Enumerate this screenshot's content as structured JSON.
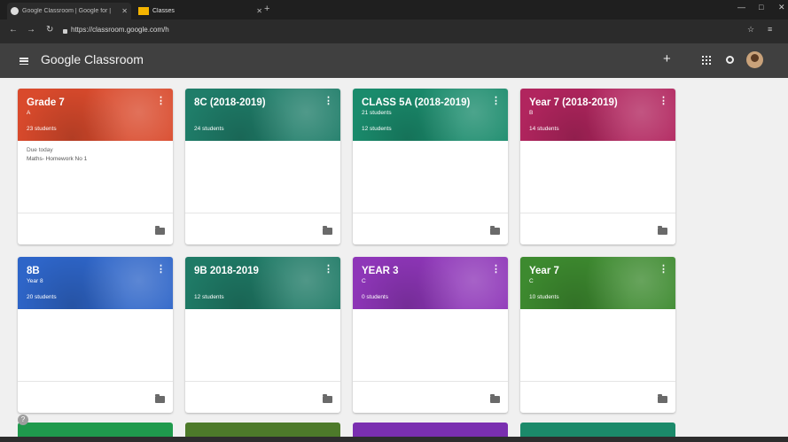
{
  "browser": {
    "tabs": [
      {
        "title": "Google Classroom | Google for |",
        "active": false
      },
      {
        "title": "Classes",
        "active": true
      }
    ],
    "url": "https://classroom.google.com/h"
  },
  "app": {
    "title": "Google Classroom"
  },
  "classes": [
    {
      "title": "Grade 7",
      "section": "A",
      "students": "23 students",
      "color": "#d94a2c",
      "due_label": "Due today",
      "due_item": "Maths- Homework No 1"
    },
    {
      "title": "8C (2018-2019)",
      "section": "",
      "students": "24 students",
      "color": "#1f7d69",
      "due_label": "",
      "due_item": ""
    },
    {
      "title": "CLASS 5A (2018-2019)",
      "section": "21 students",
      "students": "12 students",
      "color": "#1a8b6c",
      "due_label": "",
      "due_item": ""
    },
    {
      "title": "Year 7 (2018-2019)",
      "section": "B",
      "students": "14 students",
      "color": "#b1255e",
      "due_label": "",
      "due_item": ""
    },
    {
      "title": "8B",
      "section": "Year 8",
      "students": "20 students",
      "color": "#2e65c8",
      "due_label": "",
      "due_item": ""
    },
    {
      "title": "9B 2018-2019",
      "section": "",
      "students": "12 students",
      "color": "#1f7a66",
      "due_label": "",
      "due_item": ""
    },
    {
      "title": "YEAR 3",
      "section": "C",
      "students": "0 students",
      "color": "#8e36b8",
      "due_label": "",
      "due_item": ""
    },
    {
      "title": "Year 7",
      "section": "C",
      "students": "10 students",
      "color": "#3d8a2f",
      "due_label": "",
      "due_item": ""
    }
  ],
  "next_row_colors": [
    "#1f9a4d",
    "#4d7a2a",
    "#7a2fb0",
    "#1b8a6a"
  ]
}
